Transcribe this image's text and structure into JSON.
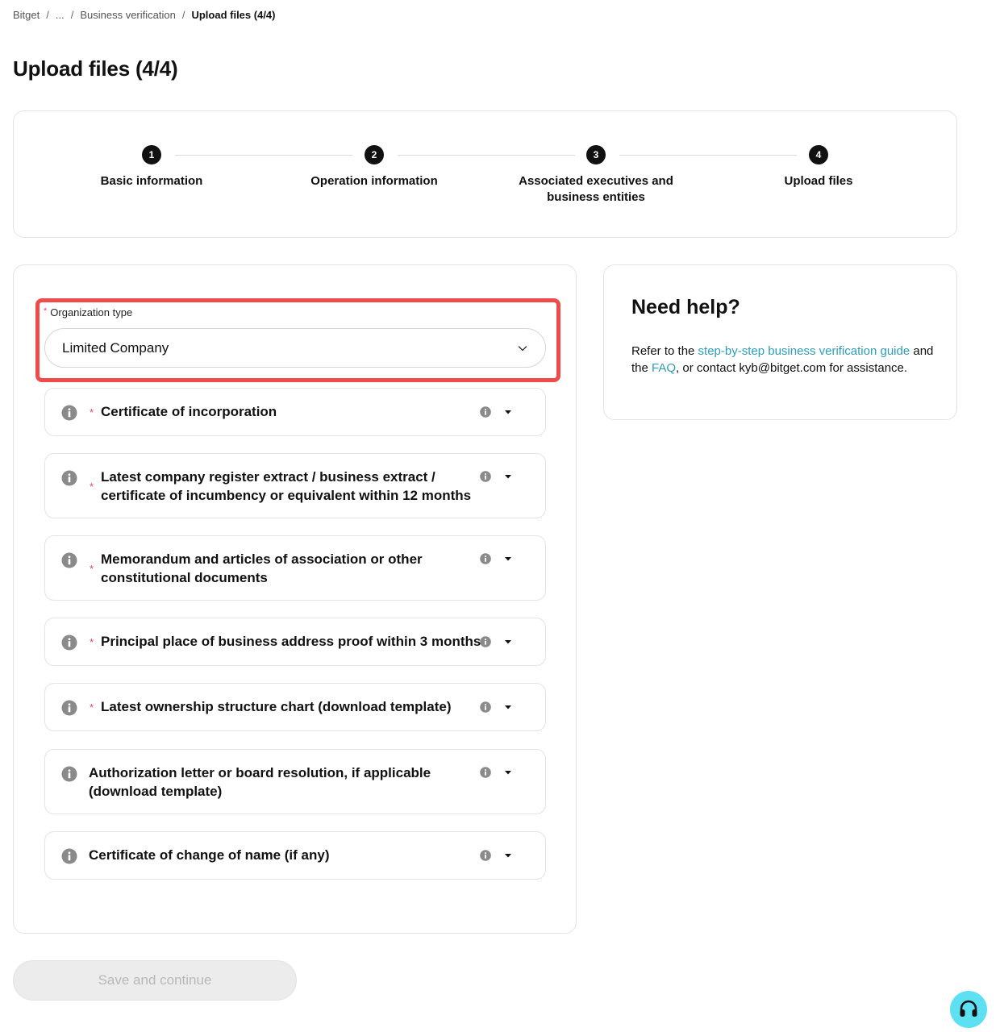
{
  "breadcrumb": {
    "root": "Bitget",
    "ellipsis": "...",
    "parent": "Business verification",
    "current": "Upload files (4/4)",
    "separator": "/"
  },
  "page_title": "Upload files (4/4)",
  "steps": [
    {
      "number": "1",
      "label": "Basic information"
    },
    {
      "number": "2",
      "label": "Operation information"
    },
    {
      "number": "3",
      "label": "Associated executives and business entities"
    },
    {
      "number": "4",
      "label": "Upload files"
    }
  ],
  "form": {
    "org_type": {
      "required_mark": "*",
      "label": "Organization type",
      "value": "Limited Company"
    },
    "documents": [
      {
        "title": "Certificate of incorporation",
        "required": true
      },
      {
        "title": "Latest company register extract / business extract / certificate of incumbency or equivalent within 12 months",
        "required": true
      },
      {
        "title": "Memorandum and articles of association or other constitutional documents",
        "required": true
      },
      {
        "title": "Principal place of business address proof within 3 months",
        "required": true
      },
      {
        "title": "Latest ownership structure chart (download template)",
        "required": true
      },
      {
        "title": "Authorization letter or board resolution, if applicable (download template)",
        "required": false
      },
      {
        "title": "Certificate of change of name (if any)",
        "required": false
      }
    ]
  },
  "help": {
    "title": "Need help?",
    "text_1": "Refer to the ",
    "link_guide": "step-by-step business verification guide",
    "text_2": " and the ",
    "link_faq": "FAQ",
    "text_3": ", or contact kyb@bitget.com for assistance."
  },
  "save_button": "Save and continue",
  "colors": {
    "accent_link": "#2f9dbd",
    "highlight_border": "#ef4b4b",
    "required": "#e0457f",
    "support_button": "#5ce0f2",
    "step_badge": "#111111"
  },
  "icons": {
    "info": "info-circle-icon",
    "hint": "small-info-icon",
    "caret": "caret-down-icon",
    "select_chevron": "chevron-down-icon",
    "support": "headset-icon"
  }
}
